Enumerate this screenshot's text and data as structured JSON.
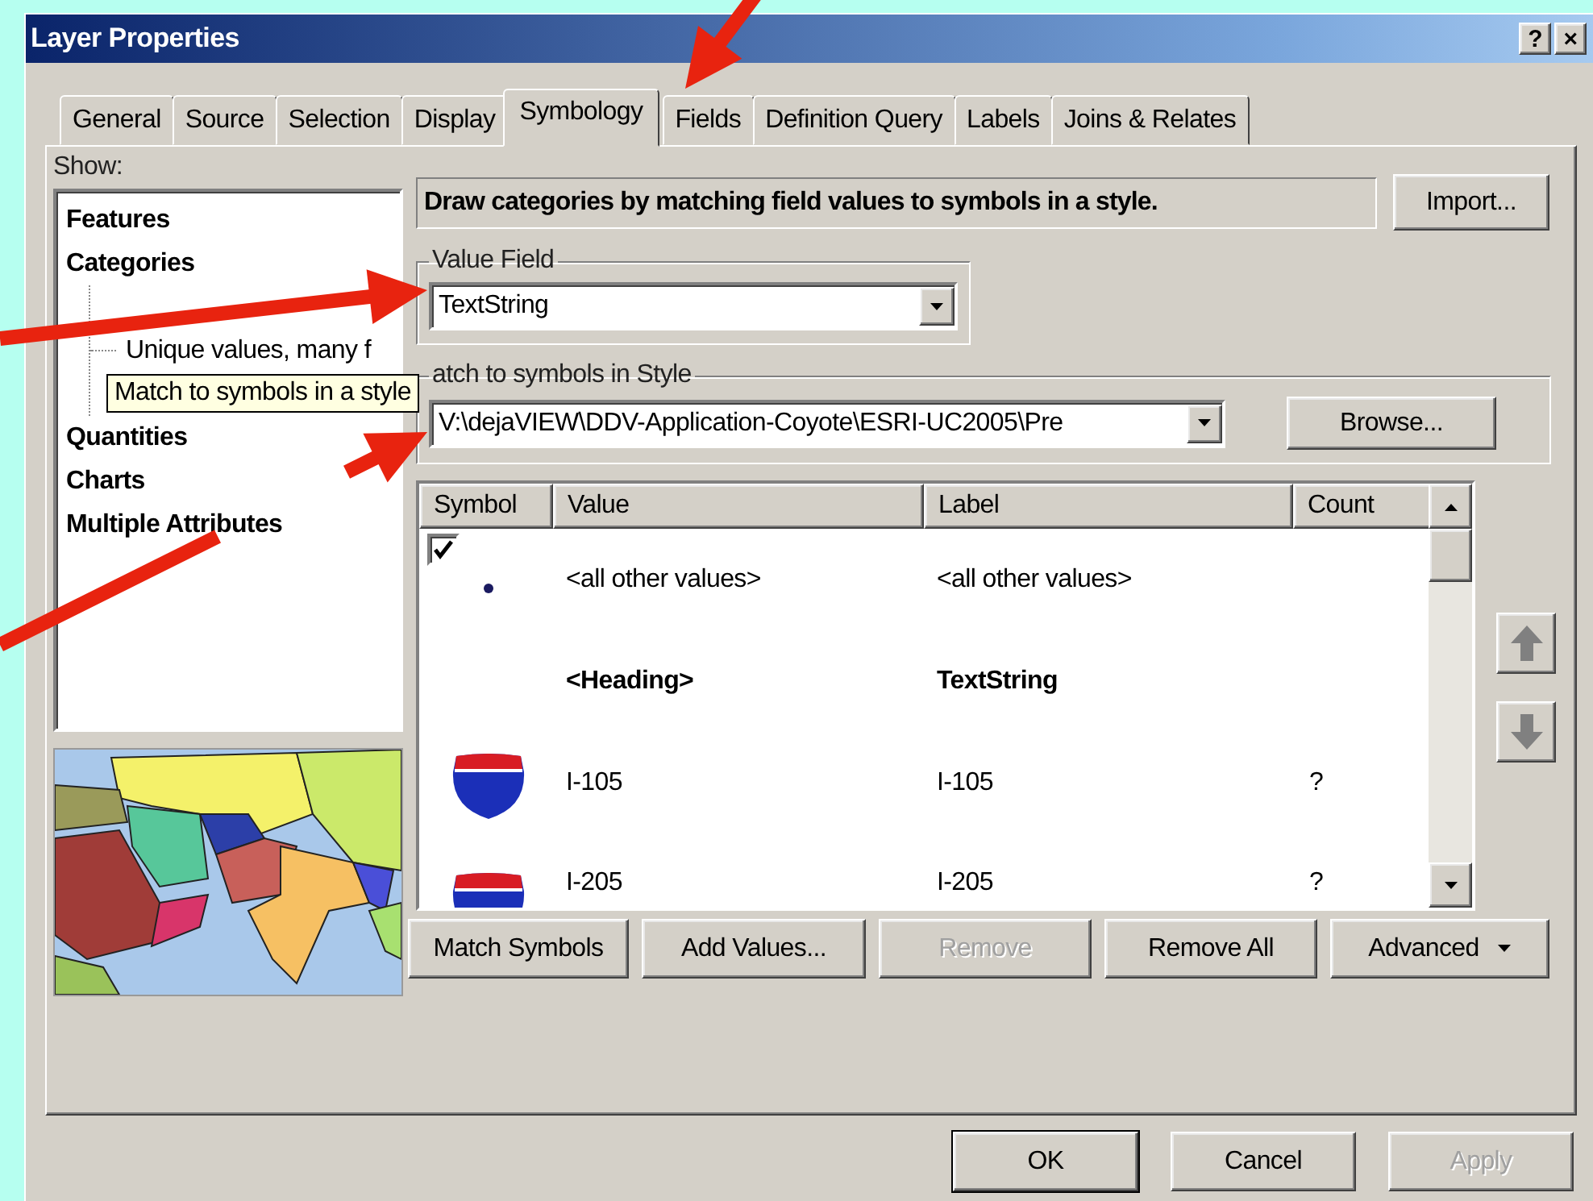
{
  "window": {
    "title": "Layer Properties",
    "help_button": "?",
    "close_button": "×"
  },
  "tabs": [
    {
      "label": "General",
      "selected": false
    },
    {
      "label": "Source",
      "selected": false
    },
    {
      "label": "Selection",
      "selected": false
    },
    {
      "label": "Display",
      "selected": false
    },
    {
      "label": "Symbology",
      "selected": true
    },
    {
      "label": "Fields",
      "selected": false
    },
    {
      "label": "Definition Query",
      "selected": false
    },
    {
      "label": "Labels",
      "selected": false
    },
    {
      "label": "Joins & Relates",
      "selected": false
    }
  ],
  "show_panel": {
    "label": "Show:",
    "tree": [
      {
        "label": "Features"
      },
      {
        "label": "Categories",
        "children": [
          {
            "label": "Unique values, many f"
          }
        ]
      },
      {
        "label": "Quantities"
      },
      {
        "label": "Charts"
      },
      {
        "label": "Multiple Attributes"
      }
    ]
  },
  "tooltip": "Match to symbols in a style",
  "description": "Draw categories by matching field values to symbols in a style.",
  "import_button": "Import...",
  "value_field": {
    "legend": "Value Field",
    "value": "TextString"
  },
  "style_field": {
    "legend": "atch to symbols in Style",
    "value": "V:\\dejaVIEW\\DDV-Application-Coyote\\ESRI-UC2005\\Pre"
  },
  "browse_button": "Browse...",
  "table": {
    "columns": [
      "Symbol",
      "Value",
      "Label",
      "Count"
    ],
    "rows": [
      {
        "kind": "other",
        "checked": true,
        "value": "<all other values>",
        "label": "<all other values>"
      },
      {
        "kind": "heading",
        "value": "<Heading>",
        "label": "TextString"
      },
      {
        "kind": "shield",
        "value": "I-105",
        "label": "I-105",
        "count": "?"
      },
      {
        "kind": "shield",
        "value": "I-205",
        "label": "I-205",
        "count": "?"
      }
    ]
  },
  "action_buttons": [
    {
      "label": "Match Symbols",
      "kind": "plain",
      "disabled": false
    },
    {
      "label": "Add Values...",
      "kind": "plain",
      "disabled": false
    },
    {
      "label": "Remove",
      "kind": "plain",
      "disabled": true
    },
    {
      "label": "Remove All",
      "kind": "plain",
      "disabled": false
    },
    {
      "label": "Advanced",
      "kind": "menu",
      "disabled": false
    }
  ],
  "dialog_buttons": [
    {
      "label": "OK",
      "default": true,
      "disabled": false
    },
    {
      "label": "Cancel",
      "default": false,
      "disabled": false
    },
    {
      "label": "Apply",
      "default": false,
      "disabled": true
    }
  ]
}
